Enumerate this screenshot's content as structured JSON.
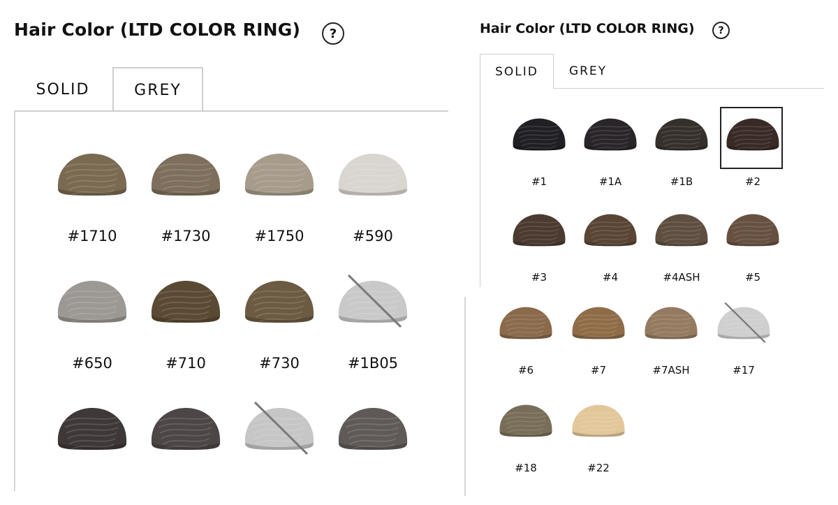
{
  "left_panel": {
    "title": "Hair Color (LTD COLOR RING)",
    "help": "?",
    "tabs": [
      "SOLID",
      "GREY"
    ],
    "active_tab": "GREY",
    "swatches": [
      {
        "label": "#1710",
        "color": "#7a6a52",
        "available": true
      },
      {
        "label": "#1730",
        "color": "#7d6f5c",
        "available": true
      },
      {
        "label": "#1750",
        "color": "#a79c8c",
        "available": true
      },
      {
        "label": "#590",
        "color": "#d9d6d0",
        "available": true
      },
      {
        "label": "#650",
        "color": "#9c9893",
        "available": true
      },
      {
        "label": "#710",
        "color": "#5b4a33",
        "available": true
      },
      {
        "label": "#730",
        "color": "#6c5b42",
        "available": true
      },
      {
        "label": "#1B05",
        "color": "#c9c9c9",
        "available": false
      },
      {
        "label": "",
        "color": "#3f3838",
        "available": true
      },
      {
        "label": "",
        "color": "#4d4646",
        "available": true
      },
      {
        "label": "",
        "color": "#c6c6c6",
        "available": false
      },
      {
        "label": "",
        "color": "#5f5a57",
        "available": true
      }
    ]
  },
  "right_panel": {
    "title": "Hair Color (LTD COLOR RING)",
    "help": "?",
    "tabs": [
      "SOLID",
      "GREY"
    ],
    "active_tab": "SOLID",
    "selected": "#2",
    "swatches": [
      {
        "label": "#1",
        "color": "#1f1f24",
        "available": true
      },
      {
        "label": "#1A",
        "color": "#2a2529",
        "available": true
      },
      {
        "label": "#1B",
        "color": "#35302b",
        "available": true
      },
      {
        "label": "#2",
        "color": "#3a2a26",
        "available": true
      },
      {
        "label": "#3",
        "color": "#4a3a30",
        "available": true
      },
      {
        "label": "#4",
        "color": "#5a4535",
        "available": true
      },
      {
        "label": "#4ASH",
        "color": "#5e4e40",
        "available": true
      },
      {
        "label": "#5",
        "color": "#665040",
        "available": true
      },
      {
        "label": "#6",
        "color": "#8a6a4a",
        "available": true
      },
      {
        "label": "#7",
        "color": "#8f6c48",
        "available": true
      },
      {
        "label": "#7ASH",
        "color": "#947a60",
        "available": true
      },
      {
        "label": "#17",
        "color": "#cfcfcf",
        "available": false
      },
      {
        "label": "#18",
        "color": "#786e58",
        "available": true
      },
      {
        "label": "#22",
        "color": "#e2c79a",
        "available": true
      }
    ]
  }
}
